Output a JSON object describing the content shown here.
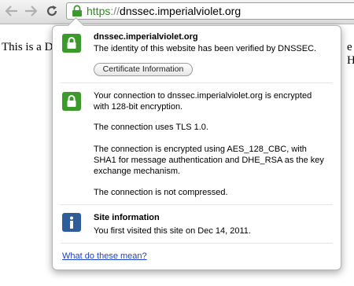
{
  "toolbar": {
    "back_icon": "arrow-left-icon",
    "forward_icon": "arrow-right-icon",
    "reload_icon": "reload-icon",
    "url": {
      "scheme": "https",
      "separator": "://",
      "host": "dnssec.imperialviolet.org"
    }
  },
  "page": {
    "text_left": "This is a D",
    "text_right": "e H"
  },
  "popup": {
    "identity": {
      "title": "dnssec.imperialviolet.org",
      "description": "The identity of this website has been verified by DNSSEC.",
      "button_label": "Certificate Information"
    },
    "connection": {
      "line1": "Your connection to dnssec.imperialviolet.org is encrypted",
      "line2": "with 128-bit encryption.",
      "tls": "The connection uses TLS 1.0.",
      "cipher_line1": "The connection is encrypted using AES_128_CBC, with",
      "cipher_line2": "SHA1 for message authentication and DHE_RSA as the key",
      "cipher_line3": "exchange mechanism.",
      "compression": "The connection is not compressed."
    },
    "site_info": {
      "title": "Site information",
      "description": "You first visited this site on Dec 14, 2011."
    },
    "help_link": "What do these mean?"
  },
  "colors": {
    "lock_green": "#3c9a2c",
    "info_blue": "#2f5d9a",
    "url_green": "#2c8a1c",
    "link_blue": "#1a3fcc"
  }
}
